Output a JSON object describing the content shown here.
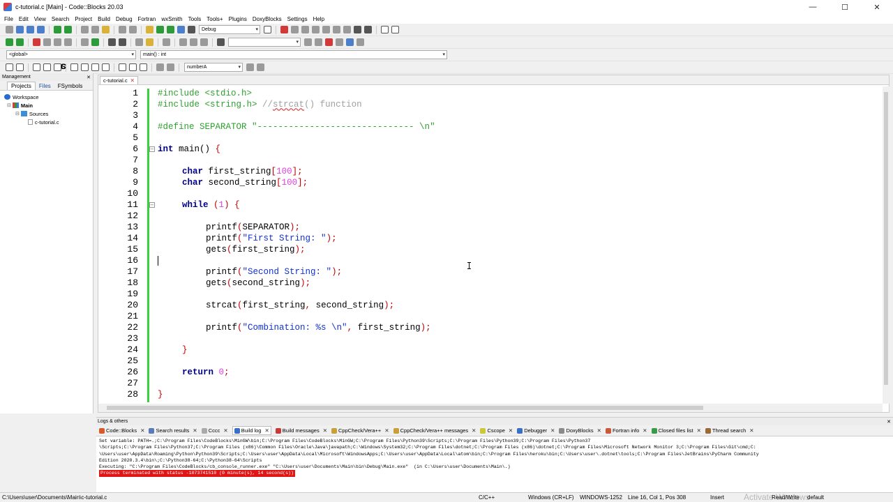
{
  "window": {
    "title": "c-tutorial.c [Main] - Code::Blocks 20.03",
    "controls": {
      "minimize": "—",
      "maximize": "☐",
      "close": "✕"
    }
  },
  "menu": [
    "File",
    "Edit",
    "View",
    "Search",
    "Project",
    "Build",
    "Debug",
    "Fortran",
    "wxSmith",
    "Tools",
    "Tools+",
    "Plugins",
    "DoxyBlocks",
    "Settings",
    "Help"
  ],
  "toolbar": {
    "build_target": "Debug",
    "scope_combo": "<global>",
    "function_combo": "main() : int",
    "search_combo": "numberA",
    "s_label": "S",
    "c_label": "C"
  },
  "management": {
    "title": "Management",
    "tabs": [
      "Projects",
      "Files",
      "FSymbols"
    ],
    "tree": [
      {
        "label": "Workspace",
        "icon": "workspace-icon"
      },
      {
        "label": "Main",
        "icon": "project-icon"
      },
      {
        "label": "Sources",
        "icon": "folder-icon"
      },
      {
        "label": "c-tutorial.c",
        "icon": "file-icon"
      }
    ]
  },
  "editor": {
    "tab": "c-tutorial.c",
    "lines": [
      {
        "n": "1"
      },
      {
        "n": "2"
      },
      {
        "n": "3"
      },
      {
        "n": "4"
      },
      {
        "n": "5"
      },
      {
        "n": "6"
      },
      {
        "n": "7"
      },
      {
        "n": "8"
      },
      {
        "n": "9"
      },
      {
        "n": "10"
      },
      {
        "n": "11"
      },
      {
        "n": "12"
      },
      {
        "n": "13"
      },
      {
        "n": "14"
      },
      {
        "n": "15"
      },
      {
        "n": "16"
      },
      {
        "n": "17"
      },
      {
        "n": "18"
      },
      {
        "n": "19"
      },
      {
        "n": "20"
      },
      {
        "n": "21"
      },
      {
        "n": "22"
      },
      {
        "n": "23"
      },
      {
        "n": "24"
      },
      {
        "n": "25"
      },
      {
        "n": "26"
      },
      {
        "n": "27"
      },
      {
        "n": "28"
      }
    ],
    "code": {
      "l1_pre": "#include <stdio.h>",
      "l2_pre": "#include <string.h>",
      "l2_cmt_a": " //",
      "l2_cmt_word": "strcat",
      "l2_cmt_b": "() function",
      "l4_pre": "#define SEPARATOR \"------------------------------ \\n\"",
      "l6_kw": "int",
      "l6_a": " main() ",
      "l6_b": "{",
      "l8_kw": "char",
      "l8_a": " first_string",
      "l8_b": "[",
      "l8_num": "100",
      "l8_c": "];",
      "l9_kw": "char",
      "l9_a": " second_string",
      "l9_b": "[",
      "l9_num": "100",
      "l9_c": "];",
      "l11_kw": "while",
      "l11_a": " ",
      "l11_b": "(",
      "l11_num": "1",
      "l11_c": ")",
      "l11_d": " {",
      "l13_a": "printf",
      "l13_b": "(",
      "l13_c": "SEPARATOR",
      "l13_d": ");",
      "l14_a": "printf",
      "l14_b": "(",
      "l14_str": "\"First String: \"",
      "l14_c": ");",
      "l15_a": "gets",
      "l15_b": "(",
      "l15_c": "first_string",
      "l15_d": ");",
      "l17_a": "printf",
      "l17_b": "(",
      "l17_str": "\"Second String: \"",
      "l17_c": ");",
      "l18_a": "gets",
      "l18_b": "(",
      "l18_c": "second_string",
      "l18_d": ");",
      "l20_a": "strcat",
      "l20_b": "(",
      "l20_c": "first_string",
      "l20_d": ",",
      "l20_e": " second_string",
      "l20_f": ");",
      "l22_a": "printf",
      "l22_b": "(",
      "l22_str": "\"Combination: %s \\n\"",
      "l22_c": ",",
      "l22_d": " first_string",
      "l22_e": ");",
      "l24": "}",
      "l26_kw": "return",
      "l26_a": " ",
      "l26_num": "0",
      "l26_b": ";",
      "l28": "}"
    }
  },
  "logs": {
    "title": "Logs & others",
    "tabs": [
      {
        "label": "Code::Blocks",
        "icon": "codeblocks-icon"
      },
      {
        "label": "Search results",
        "icon": "search-icon"
      },
      {
        "label": "Cccc",
        "icon": "cccc-icon"
      },
      {
        "label": "Build log",
        "icon": "gear-icon"
      },
      {
        "label": "Build messages",
        "icon": "build-messages-icon"
      },
      {
        "label": "CppCheck/Vera++",
        "icon": "check-icon"
      },
      {
        "label": "CppCheck/Vera++ messages",
        "icon": "check-icon"
      },
      {
        "label": "Cscope",
        "icon": "cscope-icon"
      },
      {
        "label": "Debugger",
        "icon": "debugger-icon"
      },
      {
        "label": "DoxyBlocks",
        "icon": "doxyblocks-icon"
      },
      {
        "label": "Fortran info",
        "icon": "fortran-icon"
      },
      {
        "label": "Closed files list",
        "icon": "closed-files-icon"
      },
      {
        "label": "Thread search",
        "icon": "thread-search-icon"
      }
    ],
    "body": [
      "Set variable: PATH=.;C:\\Program Files\\CodeBlocks\\MinGW\\bin;C:\\Program Files\\CodeBlocks\\MinGW;C:\\Program Files\\Python39\\Scripts;C:\\Program Files\\Python39;C:\\Program Files\\Python37",
      "\\Scripts;C:\\Program Files\\Python37;C:\\Program Files (x86)\\Common Files\\Oracle\\Java\\javapath;C:\\Windows\\System32;C:\\Program Files\\dotnet;C:\\Program Files (x86)\\dotnet;C:\\Program Files\\Microsoft Network Monitor 3;C:\\Program Files\\Git\\cmd;C:",
      "\\Users\\user\\AppData\\Roaming\\Python\\Python39\\Scripts;C:\\Users\\user\\AppData\\Local\\Microsoft\\WindowsApps;C:\\Users\\user\\AppData\\Local\\atom\\bin;C:\\Program Files\\heroku\\bin;C:\\Users\\user\\.dotnet\\tools;C:\\Program Files\\JetBrains\\PyCharm Community",
      "Edition 2020.3.4\\bin\\;C:\\Python38-64;C:\\Python38-64\\Scripts",
      "Executing: \"C:\\Program Files\\CodeBlocks/cb_console_runner.exe\" \"C:\\Users\\user\\Documents\\Main\\bin\\Debug\\Main.exe\"  (in C:\\Users\\user\\Documents\\Main\\.)"
    ],
    "error_line": "Process terminated with status -1073741510 (0 minute(s), 14 second(s))"
  },
  "status": {
    "path": "C:\\Users\\user\\Documents\\Main\\c-tutorial.c",
    "language": "C/C++",
    "line_endings": "Windows (CR+LF)",
    "encoding": "WINDOWS-1252",
    "position": "Line 16, Col 1, Pos 308",
    "mode": "Insert",
    "access": "Read/Write",
    "profile": "default",
    "watermark": "Activate Windows"
  },
  "colors": {
    "preprocessor": "#2fa02f",
    "comment": "#a0a0a0",
    "keyword": "#00008b",
    "string": "#1030d0",
    "number": "#e040e0",
    "operator": "#c00000",
    "changebar": "#3cd03c",
    "error_bg": "#e01515"
  }
}
